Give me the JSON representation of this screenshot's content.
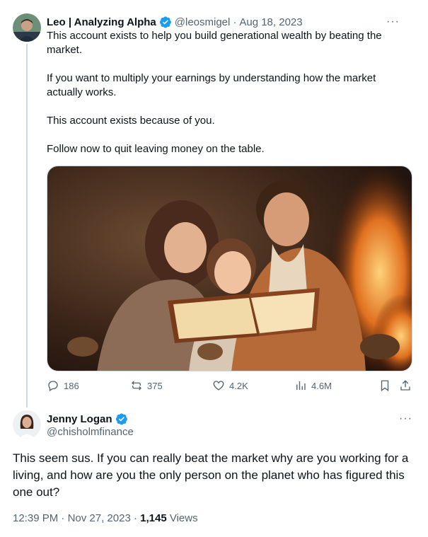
{
  "tweet": {
    "author_name": "Leo | Analyzing Alpha",
    "author_handle": "@leosmigel",
    "separator": "·",
    "date": "Aug 18, 2023",
    "more_glyph": "···",
    "paragraphs": [
      "This account exists to help you build generational wealth by beating the market.",
      "If you want to multiply your earnings by understanding how the market actually works.",
      "This account exists because of you.",
      "Follow now to quit leaving money on the table."
    ],
    "media_description_icon": "family-reading-book-photo",
    "actions": {
      "replies": "186",
      "reposts": "375",
      "likes": "4.2K",
      "views": "4.6M"
    }
  },
  "reply": {
    "author_name": "Jenny Logan",
    "author_handle": "@chisholmfinance",
    "more_glyph": "···",
    "text": "This seem sus. If you can really beat the market why are you working for a living, and how are you the only person on the planet who has figured this one out?",
    "time": "12:39 PM",
    "separator": "·",
    "date": "Nov 27, 2023",
    "separator2": "·",
    "views_count": "1,145",
    "views_label": "Views"
  },
  "colors": {
    "verified": "#1d9bf0",
    "muted": "#536471",
    "text": "#0f1419",
    "line": "#cfd9de"
  }
}
